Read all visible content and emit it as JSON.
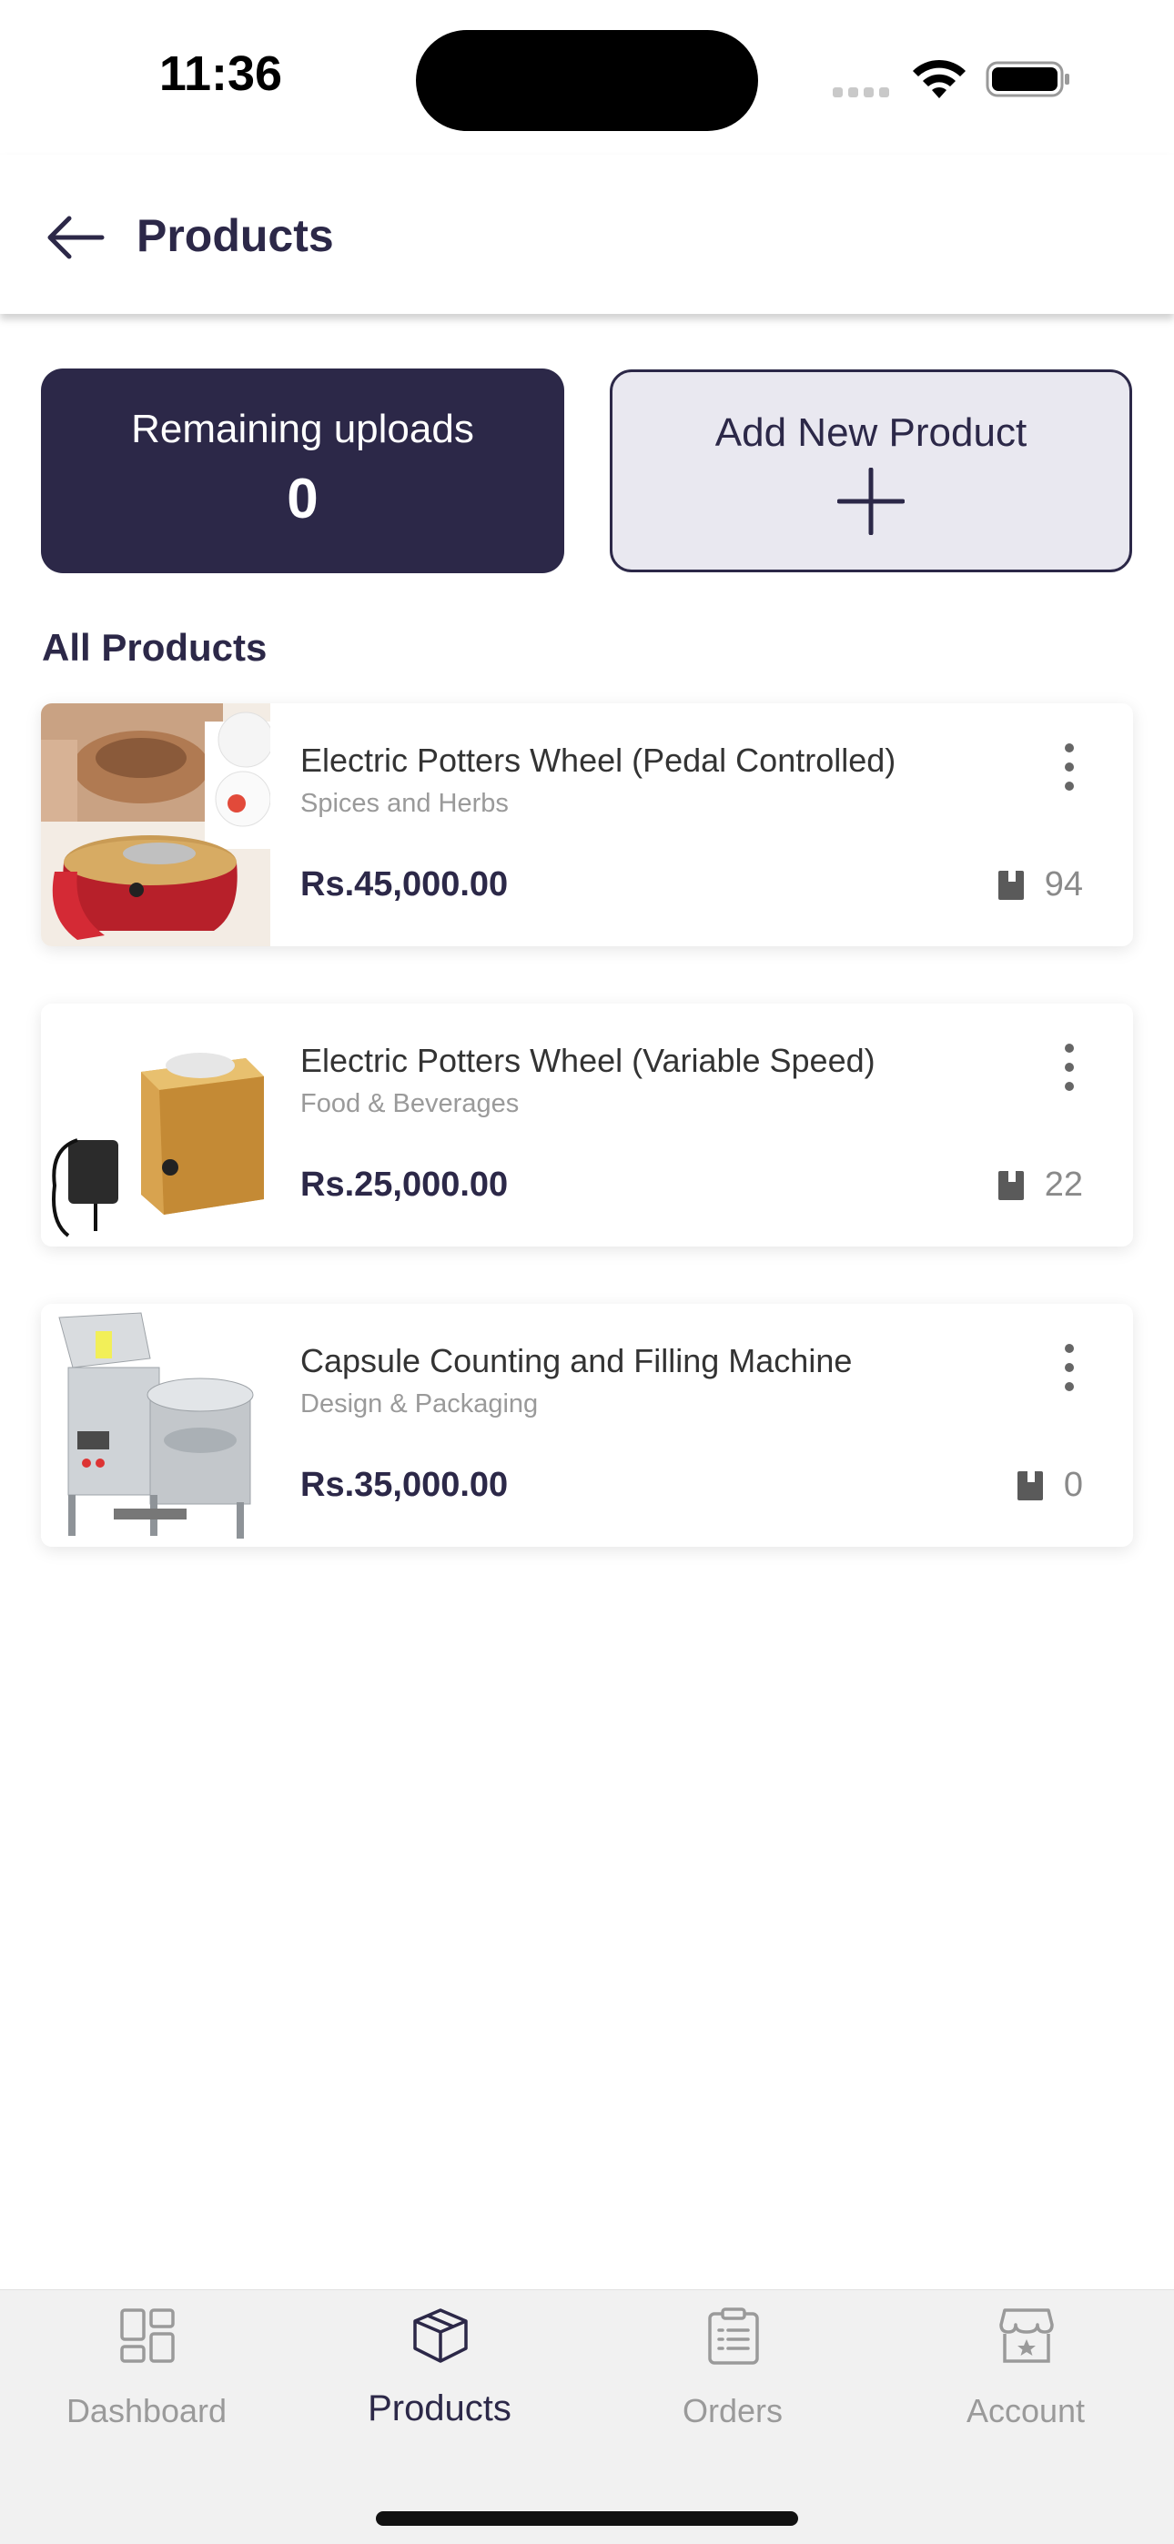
{
  "status_bar": {
    "time": "11:36"
  },
  "header": {
    "title": "Products",
    "back_icon": "arrow-left-icon"
  },
  "summary": {
    "uploads_label": "Remaining uploads",
    "uploads_count": "0",
    "add_label": "Add New Product"
  },
  "section_title": "All Products",
  "products": [
    {
      "name": "Electric Potters Wheel (Pedal Controlled)",
      "category": "Spices and Herbs",
      "price": "Rs.45,000.00",
      "stock": "94"
    },
    {
      "name": "Electric Potters Wheel (Variable Speed)",
      "category": "Food & Beverages",
      "price": "Rs.25,000.00",
      "stock": "22"
    },
    {
      "name": "Capsule Counting and Filling Machine",
      "category": "Design & Packaging",
      "price": "Rs.35,000.00",
      "stock": "0"
    }
  ],
  "nav": {
    "active": "Products",
    "items": [
      {
        "label": "Dashboard",
        "icon": "dashboard-grid-icon"
      },
      {
        "label": "Products",
        "icon": "box-icon"
      },
      {
        "label": "Orders",
        "icon": "clipboard-list-icon"
      },
      {
        "label": "Account",
        "icon": "storefront-icon"
      }
    ]
  },
  "colors": {
    "primary": "#2c2848",
    "add_card_bg": "#e9e8f0",
    "nav_bg": "#f1f1f1",
    "muted": "#9a9a9a"
  }
}
